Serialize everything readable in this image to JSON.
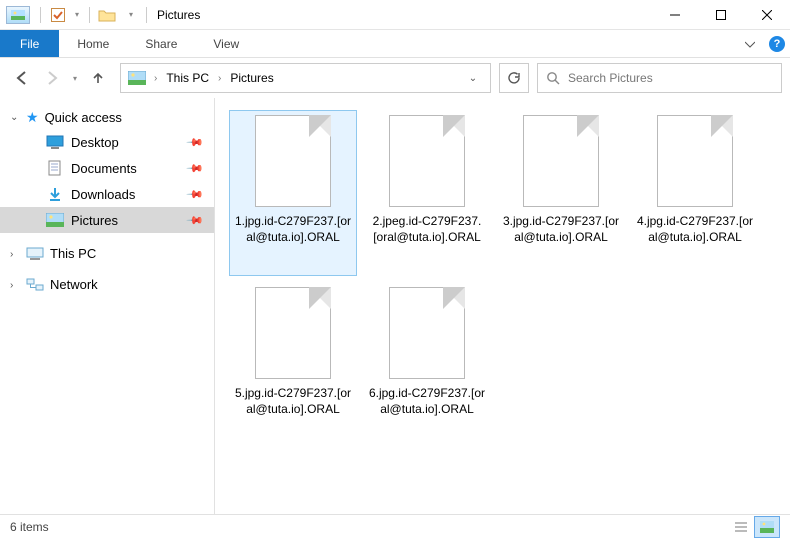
{
  "titlebar": {
    "title": "Pictures"
  },
  "ribbon": {
    "file": "File",
    "tabs": [
      "Home",
      "Share",
      "View"
    ]
  },
  "breadcrumb": {
    "segments": [
      "This PC",
      "Pictures"
    ]
  },
  "search": {
    "placeholder": "Search Pictures"
  },
  "sidebar": {
    "quick_access": "Quick access",
    "items": [
      {
        "label": "Desktop",
        "icon": "desktop"
      },
      {
        "label": "Documents",
        "icon": "documents"
      },
      {
        "label": "Downloads",
        "icon": "downloads"
      },
      {
        "label": "Pictures",
        "icon": "pictures",
        "selected": true
      }
    ],
    "this_pc": "This PC",
    "network": "Network"
  },
  "files": [
    {
      "name": "1.jpg.id-C279F237.[oral@tuta.io].ORAL",
      "selected": true
    },
    {
      "name": "2.jpeg.id-C279F237.[oral@tuta.io].ORAL"
    },
    {
      "name": "3.jpg.id-C279F237.[oral@tuta.io].ORAL"
    },
    {
      "name": "4.jpg.id-C279F237.[oral@tuta.io].ORAL"
    },
    {
      "name": "5.jpg.id-C279F237.[oral@tuta.io].ORAL"
    },
    {
      "name": "6.jpg.id-C279F237.[oral@tuta.io].ORAL"
    }
  ],
  "statusbar": {
    "count_label": "6 items"
  }
}
